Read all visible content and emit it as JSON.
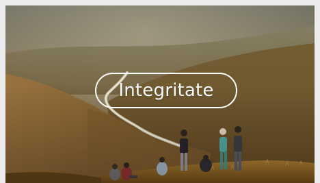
{
  "hero": {
    "image_subject": "hikers-on-hillside-above-river-valley",
    "cta_label": "Integritate"
  },
  "colors": {
    "frame_background": "#ececec",
    "cta_text": "#ffffff",
    "cta_border": "#ffffff"
  }
}
